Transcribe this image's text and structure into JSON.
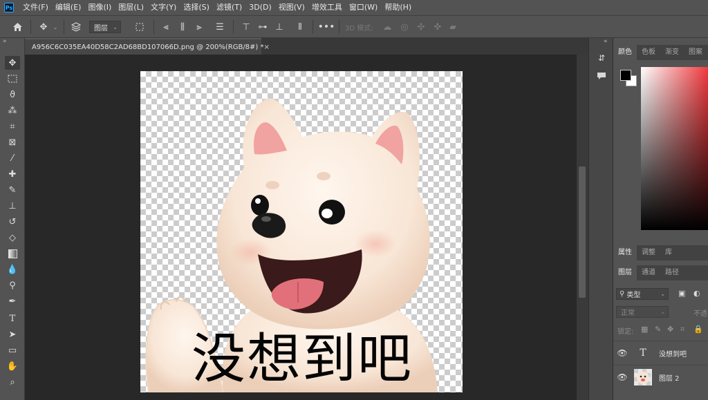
{
  "menubar": {
    "logo": "Ps",
    "items": [
      "文件(F)",
      "编辑(E)",
      "图像(I)",
      "图层(L)",
      "文字(Y)",
      "选择(S)",
      "滤镜(T)",
      "3D(D)",
      "视图(V)",
      "增效工具",
      "窗口(W)",
      "帮助(H)"
    ]
  },
  "options_bar": {
    "layer_select": "图层",
    "mode_3d_label": "3D 模式:"
  },
  "toolbar": {
    "collapse_glyph": "»"
  },
  "document": {
    "tab_title": "A956C6C035EA40D58C2AD68BD107066D.png @ 200%(RGB/8#) *",
    "close_glyph": "×",
    "caption": "没想到吧"
  },
  "panels": {
    "color_tabs": [
      "颜色",
      "色板",
      "渐变",
      "图案"
    ],
    "props_tabs": [
      "属性",
      "调整",
      "库"
    ],
    "layers_tabs": [
      "图层",
      "通道",
      "路径"
    ],
    "filter_kind": "类型",
    "blend_mode": "正常",
    "opacity_label": "不透",
    "lock_label": "锁定:",
    "layers": [
      {
        "name": "没想到吧",
        "type": "text"
      },
      {
        "name": "图层 2",
        "type": "image"
      }
    ],
    "collapse_glyph": "«"
  },
  "colors": {
    "foreground": "#000000",
    "background": "#ffffff"
  }
}
